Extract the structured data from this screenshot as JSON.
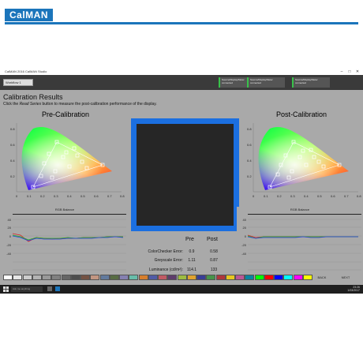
{
  "brand": {
    "logo": "CalMAN",
    "accent": "#1b75bb"
  },
  "window": {
    "title": "CalMAN 2016 CalMAN Studio",
    "tab": "Workflow 1"
  },
  "connections": [
    {
      "label": "Source/Display/Meter connected"
    },
    {
      "label": "Source/Display/Meter connected"
    },
    {
      "label": "Source/Display/Meter connected"
    }
  ],
  "page": {
    "heading": "Calibration Results",
    "instruction_prefix": "Click the ",
    "instruction_button": "Read Series",
    "instruction_suffix": " button to measure the post-calibration performance of the display."
  },
  "pre": {
    "title": "Pre-Calibration",
    "cie_ticks_x": [
      "0",
      "0.1",
      "0.2",
      "0.3",
      "0.4",
      "0.5",
      "0.6",
      "0.7",
      "0.8"
    ],
    "cie_ticks_y": [
      "0.8",
      "0.6",
      "0.4",
      "0.2"
    ],
    "rgb_title": "RGB Balance",
    "rgb_y_ticks": [
      "40",
      "20",
      "0",
      "-20",
      "-40"
    ],
    "rgb_x_ticks": [
      "0",
      "10",
      "20",
      "30",
      "40",
      "50",
      "60",
      "70",
      "80",
      "90",
      "100"
    ]
  },
  "post": {
    "title": "Post-Calibration",
    "cie_ticks_x": [
      "0",
      "0.1",
      "0.2",
      "0.3",
      "0.4",
      "0.5",
      "0.6",
      "0.7",
      "0.8"
    ],
    "cie_ticks_y": [
      "0.8",
      "0.6",
      "0.4",
      "0.2"
    ],
    "rgb_title": "RGB Balance",
    "rgb_y_ticks": [
      "40",
      "20",
      "0",
      "-20",
      "-40"
    ],
    "rgb_x_ticks": [
      "0",
      "10",
      "20",
      "30",
      "40",
      "50",
      "60",
      "70",
      "80",
      "90",
      "100"
    ]
  },
  "results": {
    "col_pre": "Pre",
    "col_post": "Post",
    "rows": [
      {
        "label": "ColorChecker Error:",
        "pre": "0.9",
        "post": "0.58"
      },
      {
        "label": "Greyscale Error:",
        "pre": "1.11",
        "post": "0.87"
      },
      {
        "label": "Luminance (cd/m²):",
        "pre": "114.1",
        "post": "133"
      }
    ]
  },
  "swatches": [
    {
      "color": "#ffffff"
    },
    {
      "color": "#e6e6e6"
    },
    {
      "color": "#cccccc"
    },
    {
      "color": "#b3b3b3"
    },
    {
      "color": "#999999"
    },
    {
      "color": "#808080"
    },
    {
      "color": "#666666"
    },
    {
      "color": "#4d4d4d"
    },
    {
      "color": "#735244"
    },
    {
      "color": "#c29682"
    },
    {
      "color": "#627a9d"
    },
    {
      "color": "#576c43"
    },
    {
      "color": "#8580b1"
    },
    {
      "color": "#67bdaa"
    },
    {
      "color": "#d67e2c"
    },
    {
      "color": "#505ba6"
    },
    {
      "color": "#c15a63"
    },
    {
      "color": "#5e3c6c"
    },
    {
      "color": "#9dbc40"
    },
    {
      "color": "#e0a32e"
    },
    {
      "color": "#383d96"
    },
    {
      "color": "#469449"
    },
    {
      "color": "#af363c"
    },
    {
      "color": "#e7c71f"
    },
    {
      "color": "#bb5695"
    },
    {
      "color": "#0885a1"
    },
    {
      "color": "#00ff00"
    },
    {
      "color": "#ff0000"
    },
    {
      "color": "#0000ff"
    },
    {
      "color": "#00ffff"
    },
    {
      "color": "#ff00ff"
    },
    {
      "color": "#ffff00"
    }
  ],
  "nav": {
    "back": "BACK",
    "next": "NEXT"
  },
  "taskbar": {
    "search": "Ask me anything",
    "time": "23:26",
    "date": "1/03/2017"
  }
}
